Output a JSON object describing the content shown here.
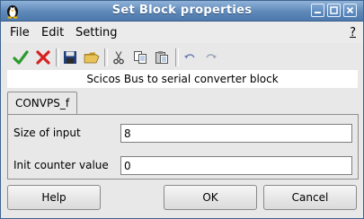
{
  "window": {
    "title": "Set Block properties"
  },
  "menubar": {
    "items": [
      "File",
      "Edit",
      "Setting"
    ],
    "help": "?"
  },
  "toolbar": {
    "icons": [
      "check-icon",
      "cross-icon",
      "save-icon",
      "open-folder-icon",
      "cut-icon",
      "copy-icon",
      "paste-icon",
      "undo-icon",
      "redo-icon"
    ]
  },
  "description": "Scicos Bus to serial converter block",
  "tab": {
    "label": "CONVPS_f"
  },
  "fields": [
    {
      "label": "Size of input",
      "value": "8"
    },
    {
      "label": "Init counter value",
      "value": "0"
    }
  ],
  "buttons": {
    "help": "Help",
    "ok": "OK",
    "cancel": "Cancel"
  },
  "colors": {
    "titlebar": "#5f88b8",
    "accept": "#2e9a2e",
    "reject": "#d62020"
  }
}
